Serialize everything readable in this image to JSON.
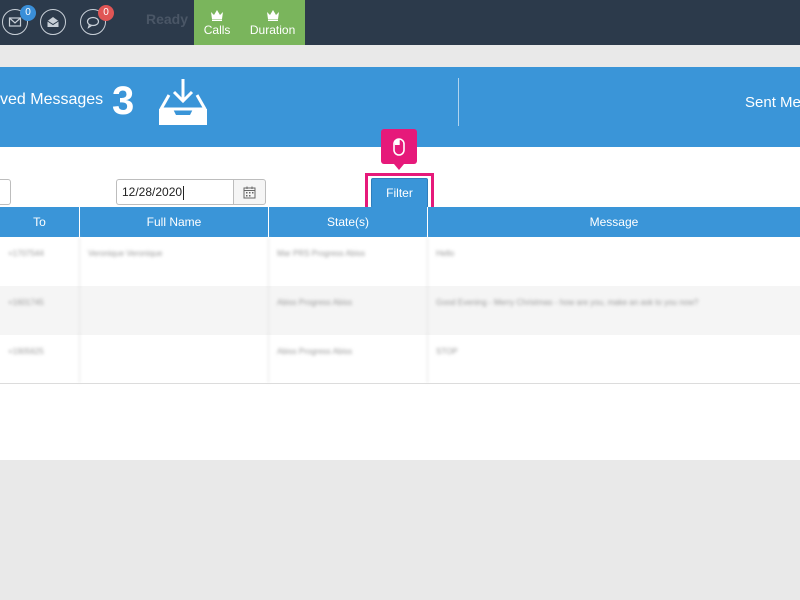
{
  "topbar": {
    "mail_badge": "0",
    "chat_badge": "0",
    "status": "Ready",
    "tabs": [
      {
        "label": "Calls",
        "icon": "crown-icon"
      },
      {
        "label": "Duration",
        "icon": "crown-icon"
      }
    ]
  },
  "band": {
    "title": "ved Messages",
    "count": "3",
    "icon": "inbox-download-icon",
    "sent_label": "Sent Me"
  },
  "filters": {
    "date_value": "12/28/2020",
    "filter_label": "Filter"
  },
  "table": {
    "headers": [
      "To",
      "Full Name",
      "State(s)",
      "Message"
    ],
    "rows": [
      [
        "+1707544",
        "Veronique Veronique",
        "Mar PRS Progress Abiss",
        "Hello"
      ],
      [
        "+1601745",
        "",
        "Abiss Progress Abiss",
        "Good Evening - Merry Christmas - how are you, make an ask to you now?"
      ],
      [
        "+1905625",
        "",
        "Abiss Progress Abiss",
        "STOP"
      ]
    ]
  },
  "colors": {
    "topbar": "#2c3a4b",
    "accent_green": "#7ab55c",
    "brand_blue": "#3a95d8",
    "highlight_pink": "#e6197a"
  }
}
